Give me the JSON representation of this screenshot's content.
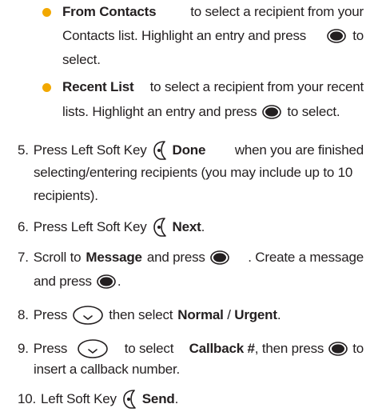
{
  "bullets": [
    {
      "title": "From Contacts",
      "line1_rest": "to select a recipient from your",
      "line2_a": "Contacts list. Highlight an entry and press",
      "line2_b": "to",
      "line3": "select."
    },
    {
      "title": "Recent List",
      "line1_rest": "to select a recipient from your recent",
      "line2_a": "lists. Highlight an entry and press",
      "line2_b": "to select."
    }
  ],
  "steps": [
    {
      "num": "5.",
      "pre": "Press Left Soft Key",
      "bold": "Done",
      "rest1": "when you are finished",
      "line2": "selecting/entering recipients (you may include up to 10",
      "line3": "recipients)."
    },
    {
      "num": "6.",
      "pre": "Press Left Soft Key",
      "bold": "Next",
      "post": "."
    },
    {
      "num": "7.",
      "pre": "Scroll to",
      "bold": "Message",
      "mid": "and press",
      "rest1": ". Create a message",
      "line2_a": "and press",
      "line2_b": "."
    },
    {
      "num": "8.",
      "pre": "Press",
      "mid": "then select",
      "bold1": "Normal",
      "sep": "/",
      "bold2": "Urgent",
      "post": "."
    },
    {
      "num": "9.",
      "pre": "Press",
      "mid": "to select",
      "bold": "Callback #",
      "rest1": ", then press",
      "rest2": "to",
      "line2": "insert a callback number."
    },
    {
      "num": "10.",
      "pre": "Left Soft Key",
      "bold": "Send",
      "post": "."
    }
  ],
  "icons": {
    "ok_label": "OK",
    "ok_key": "ok-key-icon",
    "left_soft_key": "left-soft-key-icon",
    "nav_key": "nav-key-down-icon",
    "bullet_color": "#f2a800"
  }
}
